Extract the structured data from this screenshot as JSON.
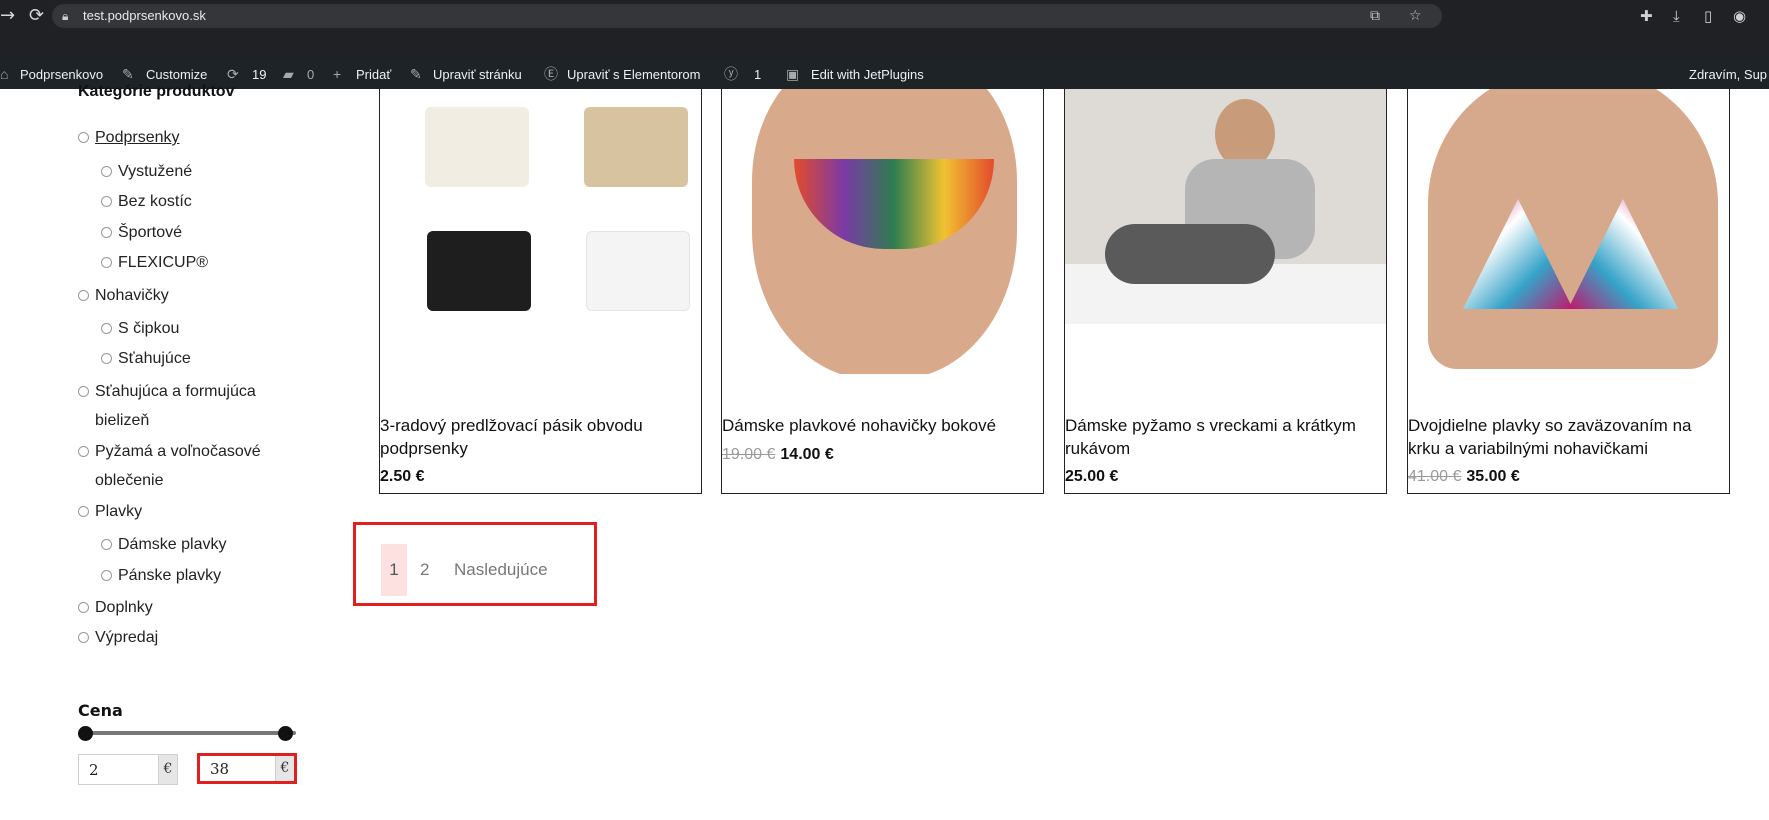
{
  "browser": {
    "url": "test.podprsenkovo.sk"
  },
  "admin_bar": {
    "site_name": "Podprsenkovo",
    "customize": "Customize",
    "updates_count": "19",
    "comments_count": "0",
    "add_new": "Pridať",
    "edit_page": "Upraviť stránku",
    "edit_elementor": "Upraviť s Elementorom",
    "yoast_count": "1",
    "jet_plugins": "Edit with JetPlugins",
    "greeting": "Zdravím, Sup"
  },
  "sidebar": {
    "title": "Kategórie produktov",
    "categories": [
      {
        "label": "Podprsenky"
      },
      {
        "label": "Vystužené"
      },
      {
        "label": "Bez kostíc"
      },
      {
        "label": "Športové"
      },
      {
        "label": "FLEXICUP®"
      },
      {
        "label": "Nohavičky"
      },
      {
        "label": "S čipkou"
      },
      {
        "label": "Sťahujúce"
      },
      {
        "label": "Sťahujúca a formujúca"
      },
      {
        "label": "bielizeň"
      },
      {
        "label": "Pyžamá a voľnočasové"
      },
      {
        "label": "oblečenie"
      },
      {
        "label": "Plavky"
      },
      {
        "label": "Dámske plavky"
      },
      {
        "label": "Pánske plavky"
      },
      {
        "label": "Doplnky"
      },
      {
        "label": "Výpredaj"
      }
    ],
    "price_filter": {
      "title": "Cena",
      "min_value": "2",
      "max_value": "38",
      "currency": "€"
    }
  },
  "products": [
    {
      "name_line1": "3-radový predlžovací pásik obvodu",
      "name_line2": "podprsenky",
      "old_price": "",
      "price": "2.50 €"
    },
    {
      "name_line1": "Dámske plavkové nohavičky bokové",
      "name_line2": "",
      "old_price": "19.00 €",
      "price": "14.00 €"
    },
    {
      "name_line1": "Dámske pyžamo s vreckami a krátkym",
      "name_line2": "rukávom",
      "old_price": "",
      "price": "25.00 €"
    },
    {
      "name_line1": "Dvojdielne plavky so zaväzovaním na",
      "name_line2": "krku a variabilnými nohavičkami",
      "old_price": "41.00 €",
      "price": "35.00 €"
    }
  ],
  "pagination": {
    "current": "1",
    "page2": "2",
    "next": "Nasledujúce"
  },
  "colors": {
    "highlight_border": "#e41e1e",
    "current_page_bg": "#fde1e1",
    "admin_bar_bg": "#1d2327"
  }
}
